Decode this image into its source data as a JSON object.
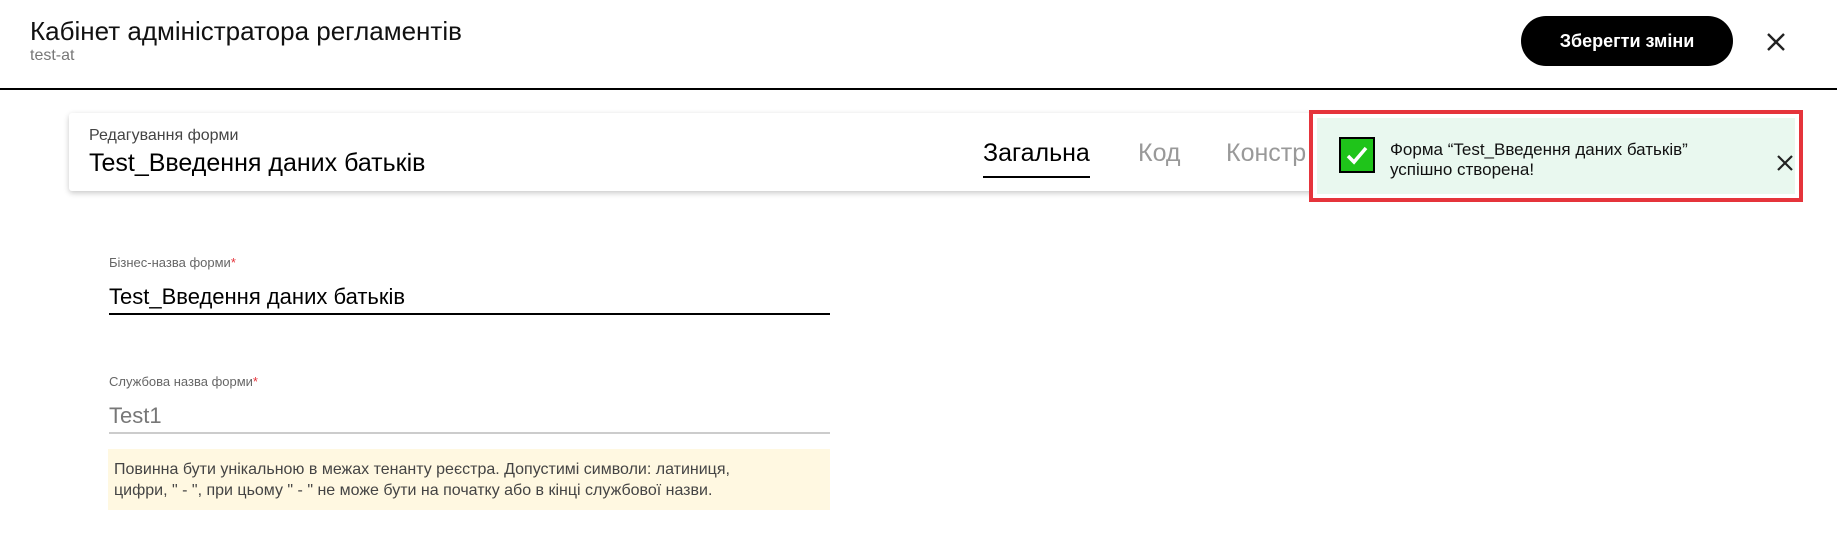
{
  "header": {
    "title": "Кабінет адміністратора регламентів",
    "subtitle": "test-at",
    "save_label": "Зберегти зміни",
    "close_icon": "close-icon"
  },
  "card": {
    "label": "Редагування форми",
    "title": "Test_Введення даних батьків",
    "tabs": [
      {
        "label": "Загальна",
        "active": true
      },
      {
        "label": "Код",
        "active": false
      },
      {
        "label": "Констр",
        "active": false
      }
    ]
  },
  "toast": {
    "line1": "Форма “Test_Введення даних батьків”",
    "line2": "успішно створена!",
    "icon": "check-icon",
    "close_icon": "close-icon",
    "accent": "#1fc41a",
    "border": "#e5343b"
  },
  "form": {
    "business_name": {
      "label": "Бізнес-назва форми",
      "required": "*",
      "value": "Test_Введення даних батьків"
    },
    "service_name": {
      "label": "Службова назва форми",
      "required": "*",
      "value": "Test1",
      "hint_line1": "Повинна бути унікальною в межах тенанту реєстра. Допустимі символи: латиниця,",
      "hint_line2": "цифри, \" - \", при цьому  \" - \" не може бути на початку або в кінці службової назви."
    }
  }
}
